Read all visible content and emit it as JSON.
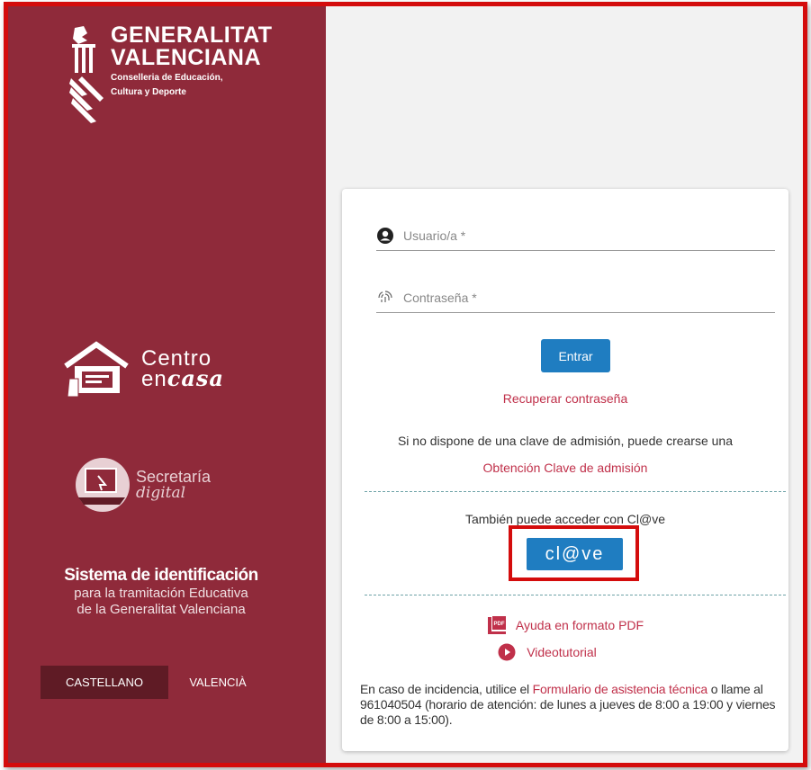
{
  "logo": {
    "line1": "GENERALITAT",
    "line2": "VALENCIANA",
    "sub1": "Conselleria de Educación,",
    "sub2": "Cultura y Deporte"
  },
  "centro": {
    "line1": "Centro",
    "line2_a": "en",
    "line2_b": "casa"
  },
  "secretaria": {
    "line1": "Secretaría",
    "line2": "digital"
  },
  "system": {
    "title": "Sistema de identificación",
    "sub1": "para la tramitación Educativa",
    "sub2": "de la Generalitat Valenciana"
  },
  "languages": {
    "active": "CASTELLANO",
    "other": "VALENCIÀ"
  },
  "login": {
    "user_placeholder": "Usuario/a *",
    "pass_placeholder": "Contraseña *",
    "submit": "Entrar",
    "recover": "Recuperar contraseña",
    "no_key_text": "Si no dispone de una clave de admisión, puede crearse una",
    "get_key": "Obtención Clave de admisión",
    "clave_text": "También puede acceder con Cl@ve",
    "clave_button": "cl@ve",
    "pdf_help": "Ayuda en formato PDF",
    "video": "Videotutorial"
  },
  "footer": {
    "pre": "En caso de incidencia, utilice el ",
    "link": "Formulario de asistencia técnica",
    "post": " o llame al 961040504 (horario de atención: de lunes a jueves de 8:00 a 19:00 y viernes de 8:00 a 15:00)."
  },
  "colors": {
    "sidebar": "#8f2a3a",
    "accent_blue": "#1f7dc1",
    "link": "#c0304a",
    "highlight": "#d40c0c"
  },
  "icons": [
    "generalitat-logo-icon",
    "house-icon",
    "laptop-icon",
    "user-icon",
    "fingerprint-icon",
    "pdf-icon",
    "play-icon"
  ]
}
